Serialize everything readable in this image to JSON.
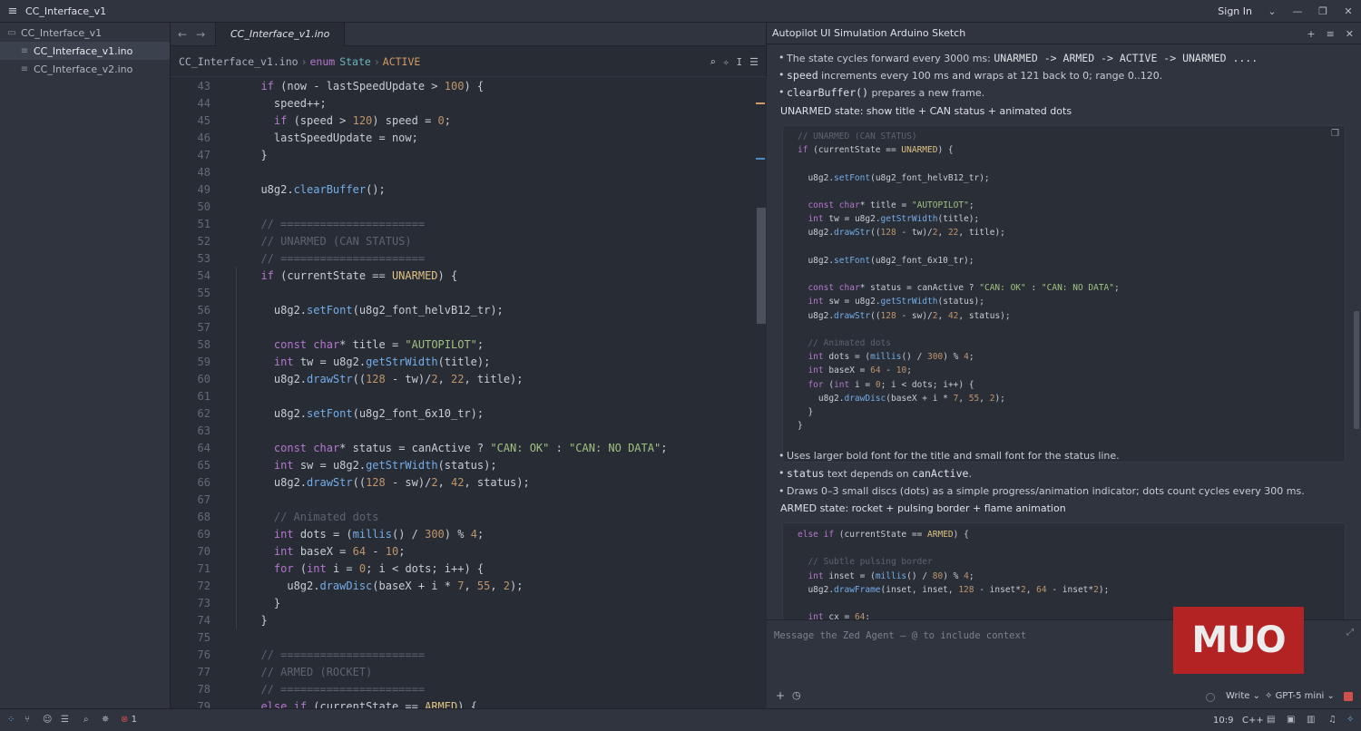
{
  "window": {
    "title": "CC_Interface_v1",
    "sign_in": "Sign In"
  },
  "sidebar": {
    "root": "CC_Interface_v1",
    "files": [
      "CC_Interface_v1.ino",
      "CC_Interface_v2.ino"
    ]
  },
  "editor": {
    "tab": "CC_Interface_v1.ino",
    "breadcrumb": {
      "file": "CC_Interface_v1.ino",
      "kw": "enum",
      "type": "State",
      "member": "ACTIVE"
    },
    "lines": [
      {
        "n": "43",
        "t": [
          [
            "  "
          ],
          [
            "if",
            "k"
          ],
          [
            " (now - lastSpeedUpdate > "
          ],
          [
            "100",
            "n"
          ],
          [
            ") {"
          ]
        ]
      },
      {
        "n": "44",
        "t": [
          [
            "    speed++;"
          ]
        ]
      },
      {
        "n": "45",
        "t": [
          [
            "    "
          ],
          [
            "if",
            "k"
          ],
          [
            " (speed > "
          ],
          [
            "120",
            "n"
          ],
          [
            ") speed = "
          ],
          [
            "0",
            "n"
          ],
          [
            ";"
          ]
        ]
      },
      {
        "n": "46",
        "t": [
          [
            "    lastSpeedUpdate = now;"
          ]
        ]
      },
      {
        "n": "47",
        "t": [
          [
            "  }"
          ]
        ]
      },
      {
        "n": "48",
        "t": [
          [
            ""
          ]
        ]
      },
      {
        "n": "49",
        "t": [
          [
            "  u8g2."
          ],
          [
            "clearBuffer",
            "f"
          ],
          [
            "();"
          ]
        ]
      },
      {
        "n": "50",
        "t": [
          [
            ""
          ]
        ]
      },
      {
        "n": "51",
        "t": [
          [
            "  // ======================",
            "c"
          ]
        ]
      },
      {
        "n": "52",
        "t": [
          [
            "  // UNARMED (CAN STATUS)",
            "c"
          ]
        ]
      },
      {
        "n": "53",
        "t": [
          [
            "  // ======================",
            "c"
          ]
        ]
      },
      {
        "n": "54",
        "t": [
          [
            "  "
          ],
          [
            "if",
            "k"
          ],
          [
            " (currentState == "
          ],
          [
            "UNARMED",
            "e"
          ],
          [
            ") {"
          ]
        ]
      },
      {
        "n": "55",
        "t": [
          [
            ""
          ]
        ]
      },
      {
        "n": "56",
        "t": [
          [
            "    u8g2."
          ],
          [
            "setFont",
            "f"
          ],
          [
            "(u8g2_font_helvB12_tr);"
          ]
        ]
      },
      {
        "n": "57",
        "t": [
          [
            ""
          ]
        ]
      },
      {
        "n": "58",
        "t": [
          [
            "    "
          ],
          [
            "const",
            "k"
          ],
          [
            " "
          ],
          [
            "char",
            "k"
          ],
          [
            "* title = "
          ],
          [
            "\"AUTOPILOT\"",
            "s"
          ],
          [
            ";"
          ]
        ]
      },
      {
        "n": "59",
        "t": [
          [
            "    "
          ],
          [
            "int",
            "k"
          ],
          [
            " tw = u8g2."
          ],
          [
            "getStrWidth",
            "f"
          ],
          [
            "(title);"
          ]
        ]
      },
      {
        "n": "60",
        "t": [
          [
            "    u8g2."
          ],
          [
            "drawStr",
            "f"
          ],
          [
            "(("
          ],
          [
            "128",
            "n"
          ],
          [
            " - tw)/"
          ],
          [
            "2",
            "n"
          ],
          [
            ", "
          ],
          [
            "22",
            "n"
          ],
          [
            ", title);"
          ]
        ]
      },
      {
        "n": "61",
        "t": [
          [
            ""
          ]
        ]
      },
      {
        "n": "62",
        "t": [
          [
            "    u8g2."
          ],
          [
            "setFont",
            "f"
          ],
          [
            "(u8g2_font_6x10_tr);"
          ]
        ]
      },
      {
        "n": "63",
        "t": [
          [
            ""
          ]
        ]
      },
      {
        "n": "64",
        "t": [
          [
            "    "
          ],
          [
            "const",
            "k"
          ],
          [
            " "
          ],
          [
            "char",
            "k"
          ],
          [
            "* status = canActive ? "
          ],
          [
            "\"CAN: OK\"",
            "s"
          ],
          [
            " : "
          ],
          [
            "\"CAN: NO DATA\"",
            "s"
          ],
          [
            ";"
          ]
        ]
      },
      {
        "n": "65",
        "t": [
          [
            "    "
          ],
          [
            "int",
            "k"
          ],
          [
            " sw = u8g2."
          ],
          [
            "getStrWidth",
            "f"
          ],
          [
            "(status);"
          ]
        ]
      },
      {
        "n": "66",
        "t": [
          [
            "    u8g2."
          ],
          [
            "drawStr",
            "f"
          ],
          [
            "(("
          ],
          [
            "128",
            "n"
          ],
          [
            " - sw)/"
          ],
          [
            "2",
            "n"
          ],
          [
            ", "
          ],
          [
            "42",
            "n"
          ],
          [
            ", status);"
          ]
        ]
      },
      {
        "n": "67",
        "t": [
          [
            ""
          ]
        ]
      },
      {
        "n": "68",
        "t": [
          [
            "    // Animated dots",
            "c"
          ]
        ]
      },
      {
        "n": "69",
        "t": [
          [
            "    "
          ],
          [
            "int",
            "k"
          ],
          [
            " dots = ("
          ],
          [
            "millis",
            "f"
          ],
          [
            "() / "
          ],
          [
            "300",
            "n"
          ],
          [
            ") % "
          ],
          [
            "4",
            "n"
          ],
          [
            ";"
          ]
        ]
      },
      {
        "n": "70",
        "t": [
          [
            "    "
          ],
          [
            "int",
            "k"
          ],
          [
            " baseX = "
          ],
          [
            "64",
            "n"
          ],
          [
            " - "
          ],
          [
            "10",
            "n"
          ],
          [
            ";"
          ]
        ]
      },
      {
        "n": "71",
        "t": [
          [
            "    "
          ],
          [
            "for",
            "k"
          ],
          [
            " ("
          ],
          [
            "int",
            "k"
          ],
          [
            " i = "
          ],
          [
            "0",
            "n"
          ],
          [
            "; i < dots; i++) {"
          ]
        ]
      },
      {
        "n": "72",
        "t": [
          [
            "      u8g2."
          ],
          [
            "drawDisc",
            "f"
          ],
          [
            "(baseX + i * "
          ],
          [
            "7",
            "n"
          ],
          [
            ", "
          ],
          [
            "55",
            "n"
          ],
          [
            ", "
          ],
          [
            "2",
            "n"
          ],
          [
            ");"
          ]
        ]
      },
      {
        "n": "73",
        "t": [
          [
            "    }"
          ]
        ]
      },
      {
        "n": "74",
        "t": [
          [
            "  }"
          ]
        ]
      },
      {
        "n": "75",
        "t": [
          [
            ""
          ]
        ]
      },
      {
        "n": "76",
        "t": [
          [
            "  // ======================",
            "c"
          ]
        ]
      },
      {
        "n": "77",
        "t": [
          [
            "  // ARMED (ROCKET)",
            "c"
          ]
        ]
      },
      {
        "n": "78",
        "t": [
          [
            "  // ======================",
            "c"
          ]
        ]
      },
      {
        "n": "79",
        "t": [
          [
            "  "
          ],
          [
            "else",
            "k"
          ],
          [
            " "
          ],
          [
            "if",
            "k"
          ],
          [
            " (currentState == "
          ],
          [
            "ARMED",
            "e"
          ],
          [
            ") {"
          ]
        ]
      }
    ]
  },
  "agent": {
    "title": "Autopilot UI Simulation Arduino Sketch",
    "b1_pre": "The state cycles forward every 3000 ms: ",
    "b1_code": "UNARMED -> ARMED -> ACTIVE -> UNARMED ....",
    "b2_code": "speed",
    "b2_text": " increments every 100 ms and wraps at 121 back to 0; range 0..120.",
    "b3_code": "clearBuffer()",
    "b3_text": " prepares a new frame.",
    "p1": "UNARMED state: show title + CAN status + animated dots",
    "block1": [
      {
        "t": [
          [
            "// UNARMED (CAN STATUS)",
            "c"
          ]
        ]
      },
      {
        "t": [
          [
            "if",
            "k"
          ],
          [
            " (currentState == "
          ],
          [
            "UNARMED",
            "e"
          ],
          [
            ") {"
          ]
        ]
      },
      {
        "t": [
          [
            ""
          ]
        ]
      },
      {
        "t": [
          [
            "  u8g2."
          ],
          [
            "setFont",
            "f"
          ],
          [
            "(u8g2_font_helvB12_tr);"
          ]
        ]
      },
      {
        "t": [
          [
            ""
          ]
        ]
      },
      {
        "t": [
          [
            "  "
          ],
          [
            "const",
            "k"
          ],
          [
            " "
          ],
          [
            "char",
            "k"
          ],
          [
            "* title = "
          ],
          [
            "\"AUTOPILOT\"",
            "s"
          ],
          [
            ";"
          ]
        ]
      },
      {
        "t": [
          [
            "  "
          ],
          [
            "int",
            "k"
          ],
          [
            " tw = u8g2."
          ],
          [
            "getStrWidth",
            "f"
          ],
          [
            "(title);"
          ]
        ]
      },
      {
        "t": [
          [
            "  u8g2."
          ],
          [
            "drawStr",
            "f"
          ],
          [
            "(("
          ],
          [
            "128",
            "n"
          ],
          [
            " - tw)/"
          ],
          [
            "2",
            "n"
          ],
          [
            ", "
          ],
          [
            "22",
            "n"
          ],
          [
            ", title);"
          ]
        ]
      },
      {
        "t": [
          [
            ""
          ]
        ]
      },
      {
        "t": [
          [
            "  u8g2."
          ],
          [
            "setFont",
            "f"
          ],
          [
            "(u8g2_font_6x10_tr);"
          ]
        ]
      },
      {
        "t": [
          [
            ""
          ]
        ]
      },
      {
        "t": [
          [
            "  "
          ],
          [
            "const",
            "k"
          ],
          [
            " "
          ],
          [
            "char",
            "k"
          ],
          [
            "* status = canActive ? "
          ],
          [
            "\"CAN: OK\"",
            "s"
          ],
          [
            " : "
          ],
          [
            "\"CAN: NO DATA\"",
            "s"
          ],
          [
            ";"
          ]
        ]
      },
      {
        "t": [
          [
            "  "
          ],
          [
            "int",
            "k"
          ],
          [
            " sw = u8g2."
          ],
          [
            "getStrWidth",
            "f"
          ],
          [
            "(status);"
          ]
        ]
      },
      {
        "t": [
          [
            "  u8g2."
          ],
          [
            "drawStr",
            "f"
          ],
          [
            "(("
          ],
          [
            "128",
            "n"
          ],
          [
            " - sw)/"
          ],
          [
            "2",
            "n"
          ],
          [
            ", "
          ],
          [
            "42",
            "n"
          ],
          [
            ", status);"
          ]
        ]
      },
      {
        "t": [
          [
            ""
          ]
        ]
      },
      {
        "t": [
          [
            "  // Animated dots",
            "c"
          ]
        ]
      },
      {
        "t": [
          [
            "  "
          ],
          [
            "int",
            "k"
          ],
          [
            " dots = ("
          ],
          [
            "millis",
            "f"
          ],
          [
            "() / "
          ],
          [
            "300",
            "n"
          ],
          [
            ") % "
          ],
          [
            "4",
            "n"
          ],
          [
            ";"
          ]
        ]
      },
      {
        "t": [
          [
            "  "
          ],
          [
            "int",
            "k"
          ],
          [
            " baseX = "
          ],
          [
            "64",
            "n"
          ],
          [
            " - "
          ],
          [
            "10",
            "n"
          ],
          [
            ";"
          ]
        ]
      },
      {
        "t": [
          [
            "  "
          ],
          [
            "for",
            "k"
          ],
          [
            " ("
          ],
          [
            "int",
            "k"
          ],
          [
            " i = "
          ],
          [
            "0",
            "n"
          ],
          [
            "; i < dots; i++) {"
          ]
        ]
      },
      {
        "t": [
          [
            "    u8g2."
          ],
          [
            "drawDisc",
            "f"
          ],
          [
            "(baseX + i * "
          ],
          [
            "7",
            "n"
          ],
          [
            ", "
          ],
          [
            "55",
            "n"
          ],
          [
            ", "
          ],
          [
            "2",
            "n"
          ],
          [
            ");"
          ]
        ]
      },
      {
        "t": [
          [
            "  }"
          ]
        ]
      },
      {
        "t": [
          [
            "}"
          ]
        ]
      }
    ],
    "b4": "Uses larger bold font for the title and small font for the status line.",
    "b5_code": "status",
    "b5_mid": " text depends on ",
    "b5_code2": "canActive",
    "b5_end": ".",
    "b6": "Draws 0–3 small discs (dots) as a simple progress/animation indicator; dots count cycles every 300 ms.",
    "p2": "ARMED state: rocket + pulsing border + flame animation",
    "block2": [
      {
        "t": [
          [
            "else",
            "k"
          ],
          [
            " "
          ],
          [
            "if",
            "k"
          ],
          [
            " (currentState == "
          ],
          [
            "ARMED",
            "e"
          ],
          [
            ") {"
          ]
        ]
      },
      {
        "t": [
          [
            ""
          ]
        ]
      },
      {
        "t": [
          [
            "  // Subtle pulsing border",
            "c"
          ]
        ]
      },
      {
        "t": [
          [
            "  "
          ],
          [
            "int",
            "k"
          ],
          [
            " inset = ("
          ],
          [
            "millis",
            "f"
          ],
          [
            "() / "
          ],
          [
            "80",
            "n"
          ],
          [
            ") % "
          ],
          [
            "4",
            "n"
          ],
          [
            ";"
          ]
        ]
      },
      {
        "t": [
          [
            "  u8g2."
          ],
          [
            "drawFrame",
            "f"
          ],
          [
            "(inset, inset, "
          ],
          [
            "128",
            "n"
          ],
          [
            " - inset*"
          ],
          [
            "2",
            "n"
          ],
          [
            ", "
          ],
          [
            "64",
            "n"
          ],
          [
            " - inset*"
          ],
          [
            "2",
            "n"
          ],
          [
            ");"
          ]
        ]
      },
      {
        "t": [
          [
            ""
          ]
        ]
      },
      {
        "t": [
          [
            "  "
          ],
          [
            "int",
            "k"
          ],
          [
            " cx = "
          ],
          [
            "64",
            "n"
          ],
          [
            ";"
          ]
        ]
      }
    ],
    "composer_placeholder": "Message the Zed Agent — @ to include context",
    "mode": "Write",
    "model": "GPT-5 mini"
  },
  "logo": "MUO",
  "status": {
    "errors": "1",
    "position": "10:9",
    "language": "C++"
  }
}
